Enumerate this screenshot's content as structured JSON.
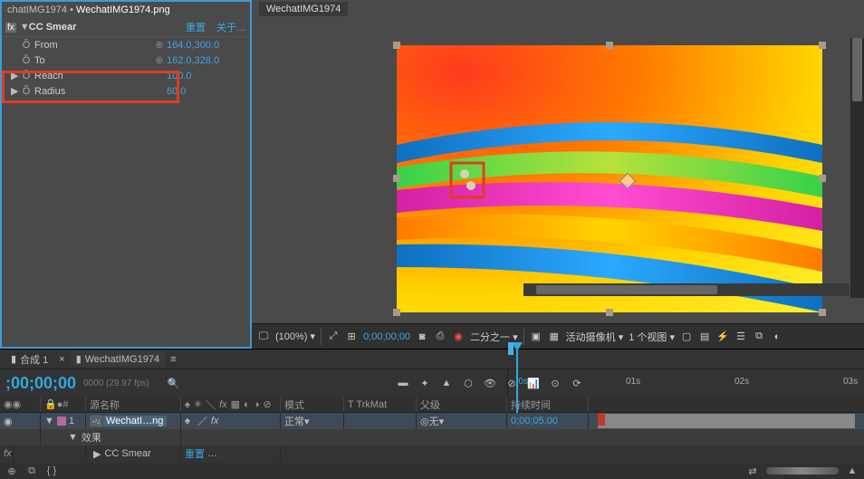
{
  "effects_panel": {
    "title_a": "chatIMG1974 •",
    "title_b": "WechatIMG1974.png",
    "fx_name": "CC Smear",
    "reset": "重置",
    "about": "关于…",
    "props": [
      {
        "name": "From",
        "value": "164.0,300.0",
        "keyframe": true
      },
      {
        "name": "To",
        "value": "162.0,328.0",
        "keyframe": true
      },
      {
        "name": "Reach",
        "value": "100.0",
        "keyframe": false
      },
      {
        "name": "Radius",
        "value": "60.0",
        "keyframe": false
      }
    ]
  },
  "viewer": {
    "tab": "WechatIMG1974",
    "toolbar": {
      "zoom": "(100%)",
      "timecode": "0;00;00;00",
      "res": "二分之一",
      "camera": "活动摄像机",
      "views": "1 个视图"
    }
  },
  "timeline": {
    "tabs": {
      "comp": "合成 1",
      "layer": "WechatIMG1974"
    },
    "timecode": ";00;00;00",
    "fps": "0000 (29.97 fps)",
    "ruler": [
      "01s",
      "02s",
      "03s"
    ],
    "ruler_start": ")0s",
    "cols": {
      "srcname": "源名称",
      "mode": "模式",
      "trkmat": "T  TrkMat",
      "parent": "父级",
      "duration": "持续时间"
    },
    "layer": {
      "idx": "1",
      "name": "WechatI…ng",
      "mode": "正常",
      "parent_none": "无",
      "duration": "0;00;05.00"
    },
    "fx_group": "效果",
    "fx_item": "CC Smear",
    "fx_reset": "重置"
  },
  "icons": {
    "tri_right": "▶",
    "tri_down": "▼",
    "stopwatch": " Õ",
    "crosshair": "⊕",
    "search": "🔍",
    "eye": "◉",
    "lock": "🔒",
    "label": "●",
    "square": "□",
    "camera": "◙",
    "grid": "▦",
    "gear": "⚙",
    "chevron": "▾",
    "menu": "≡",
    "switch": "⇄",
    "brace": "{ }"
  }
}
